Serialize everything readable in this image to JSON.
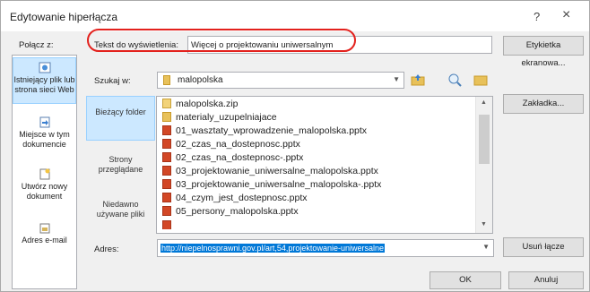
{
  "window": {
    "title": "Edytowanie hiperłącza",
    "help_glyph": "?",
    "close_glyph": "×"
  },
  "link_to": {
    "label": "Połącz z:"
  },
  "display_text": {
    "label": "Tekst do wyświetlenia:",
    "value": "Więcej o projektowaniu uniwersalnym"
  },
  "screen_tip_button": "Etykietka ekranowa...",
  "sidebar": {
    "items": [
      {
        "label": "Istniejący plik lub strona sieci Web",
        "icon": "web-page-icon",
        "selected": true
      },
      {
        "label": "Miejsce w tym dokumencie",
        "icon": "document-place-icon",
        "selected": false
      },
      {
        "label": "Utwórz nowy dokument",
        "icon": "new-document-icon",
        "selected": false
      },
      {
        "label": "Adres e-mail",
        "icon": "email-icon",
        "selected": false
      }
    ]
  },
  "look_in": {
    "label": "Szukaj w:",
    "value": "malopolska"
  },
  "places": [
    {
      "label": "Bieżący folder",
      "selected": true
    },
    {
      "label": "Strony przeglądane",
      "selected": false
    },
    {
      "label": "Niedawno używane pliki",
      "selected": false
    }
  ],
  "files": [
    {
      "name": "malopolska.zip",
      "type": "zip"
    },
    {
      "name": "materialy_uzupelniajace",
      "type": "folder"
    },
    {
      "name": "01_wasztaty_wprowadzenie_malopolska.pptx",
      "type": "pptx"
    },
    {
      "name": "02_czas_na_dostepnosc.pptx",
      "type": "pptx"
    },
    {
      "name": "02_czas_na_dostepnosc-.pptx",
      "type": "pptx"
    },
    {
      "name": "03_projektowanie_uniwersalne_malopolska.pptx",
      "type": "pptx"
    },
    {
      "name": "03_projektowanie_uniwersalne_malopolska-.pptx",
      "type": "pptx"
    },
    {
      "name": "04_czym_jest_dostepnosc.pptx",
      "type": "pptx"
    },
    {
      "name": "05_persony_malopolska.pptx",
      "type": "pptx"
    }
  ],
  "bookmark_button": "Zakładka...",
  "address": {
    "label": "Adres:",
    "value": "http://niepelnosprawni.gov.pl/art,54,projektowanie-uniwersalne"
  },
  "remove_link_button": "Usuń łącze",
  "ok_button": "OK",
  "cancel_button": "Anuluj",
  "colors": {
    "selection_blue": "#0078d7",
    "highlight_oval": "#e3211d",
    "sidebar_selected": "#cce8ff"
  }
}
